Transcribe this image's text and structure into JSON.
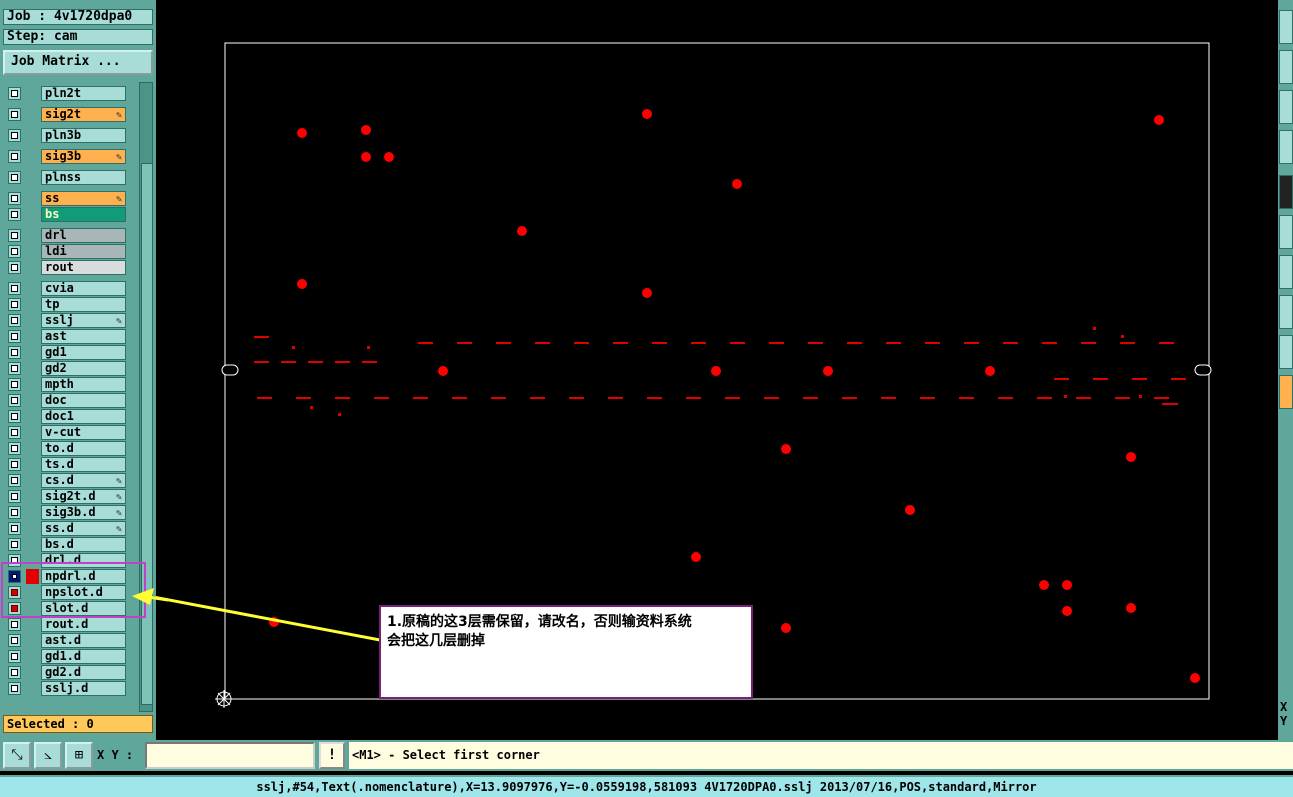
{
  "job": {
    "label": "Job : 4v1720dpa0",
    "step": "Step: cam",
    "matrix_button": "Job Matrix ..."
  },
  "layers": [
    {
      "name": "pln2t",
      "color": "default"
    },
    {
      "name": "sig2t",
      "color": "orange",
      "pen": true
    },
    {
      "name": "pln3b",
      "color": "default"
    },
    {
      "name": "sig3b",
      "color": "orange",
      "pen": true
    },
    {
      "name": "plnss",
      "color": "default"
    },
    {
      "name": "ss",
      "color": "orange",
      "pen": true
    },
    {
      "name": "bs",
      "color": "green"
    },
    {
      "name": "drl",
      "color": "grey"
    },
    {
      "name": "ldi",
      "color": "grey"
    },
    {
      "name": "rout",
      "color": "lightgrey"
    },
    {
      "name": "cvia",
      "color": "default"
    },
    {
      "name": "tp",
      "color": "default"
    },
    {
      "name": "sslj",
      "color": "default",
      "pen": true
    },
    {
      "name": "ast",
      "color": "default"
    },
    {
      "name": "gd1",
      "color": "default"
    },
    {
      "name": "gd2",
      "color": "default"
    },
    {
      "name": "mpth",
      "color": "default"
    },
    {
      "name": "doc",
      "color": "default"
    },
    {
      "name": "doc1",
      "color": "default"
    },
    {
      "name": "v-cut",
      "color": "default"
    },
    {
      "name": "to.d",
      "color": "default"
    },
    {
      "name": "ts.d",
      "color": "default"
    },
    {
      "name": "cs.d",
      "color": "default",
      "pen": true
    },
    {
      "name": "sig2t.d",
      "color": "default",
      "pen": true
    },
    {
      "name": "sig3b.d",
      "color": "default",
      "pen": true
    },
    {
      "name": "ss.d",
      "color": "default",
      "pen": true
    },
    {
      "name": "bs.d",
      "color": "default"
    },
    {
      "name": "drl.d",
      "color": "default"
    },
    {
      "name": "npdrl.d",
      "color": "default",
      "state": "work"
    },
    {
      "name": "npslot.d",
      "color": "default",
      "state": "affected"
    },
    {
      "name": "slot.d",
      "color": "default",
      "state": "affected"
    },
    {
      "name": "rout.d",
      "color": "default"
    },
    {
      "name": "ast.d",
      "color": "default"
    },
    {
      "name": "gd1.d",
      "color": "default"
    },
    {
      "name": "gd2.d",
      "color": "default"
    },
    {
      "name": "sslj.d",
      "color": "default"
    }
  ],
  "selected_label": "Selected : 0",
  "annotation": {
    "line1": "1.原稿的这3层需保留，请改名，否则输资料系统",
    "line2": "会把这几层删掉"
  },
  "command": {
    "xy_label": "X Y :",
    "xy_value": "",
    "excl": "!",
    "prompt": "<M1> - Select first corner"
  },
  "status": "sslj,#54,Text(.nomenclature),X=13.9097976,Y=-0.0559198,581093 4V1720DPA0.sslj 2013/07/16,POS,standard,Mirror",
  "right_edge": {
    "x": "X",
    "y": "Y"
  },
  "colors": {
    "panel": "#5fa79a",
    "feature": "#ff0000",
    "profile": "#ffffff",
    "orange": "#ffb14f",
    "green": "#119c77"
  },
  "icons": [
    "zoom-area-icon",
    "measure-icon",
    "grid-snap-icon",
    "origin-icon"
  ]
}
